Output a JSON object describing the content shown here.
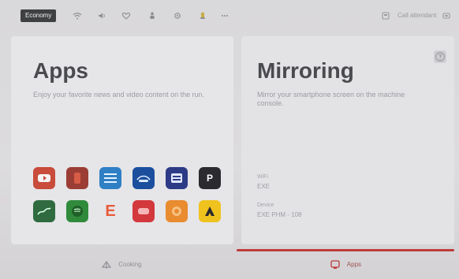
{
  "statusbar": {
    "badge": "Economy",
    "icons": [
      "wifi-icon",
      "audio-icon",
      "heart-icon",
      "person-icon",
      "gear-icon",
      "seat-icon",
      "more-icon"
    ],
    "right_text": "Call attendant",
    "right_icons": [
      "screen-icon",
      "light-icon"
    ]
  },
  "apps_panel": {
    "title": "Apps",
    "description": "Enjoy your favorite news and video content on the run.",
    "apps": [
      {
        "name": "youtube-app-icon",
        "label": "",
        "color": "#c84b3b"
      },
      {
        "name": "red-app-icon",
        "label": "",
        "color": "#9b3d34"
      },
      {
        "name": "blue-list-app-icon",
        "label": "",
        "color": "#2f7fc4"
      },
      {
        "name": "disney-app-icon",
        "label": "",
        "color": "#1b4f9e"
      },
      {
        "name": "navy-grid-app-icon",
        "label": "",
        "color": "#2d3b86"
      },
      {
        "name": "p-app-icon",
        "label": "P",
        "color": "#2a2a2f"
      },
      {
        "name": "green-chart-app-icon",
        "label": "",
        "color": "#2f6b3f"
      },
      {
        "name": "spotify-app-icon",
        "label": "",
        "color": "#2f8b3b"
      },
      {
        "name": "e-app-icon",
        "label": "E",
        "color": "#e85b3b"
      },
      {
        "name": "cnn-app-icon",
        "label": "",
        "color": "#d3383d"
      },
      {
        "name": "orange-app-icon",
        "label": "",
        "color": "#e98b2f"
      },
      {
        "name": "yellow-app-icon",
        "label": "",
        "color": "#f0c21d"
      }
    ]
  },
  "mirroring_panel": {
    "title": "Mirroring",
    "description": "Mirror your smartphone screen on the machine console.",
    "wifi_label": "WiFi",
    "wifi_value": "EXE",
    "device_label": "Device",
    "device_value": "EXE PHM - 108"
  },
  "bottombar": {
    "left_label": "Cooking",
    "right_label": "Apps"
  },
  "colors": {
    "accent": "#bf3b3b"
  }
}
